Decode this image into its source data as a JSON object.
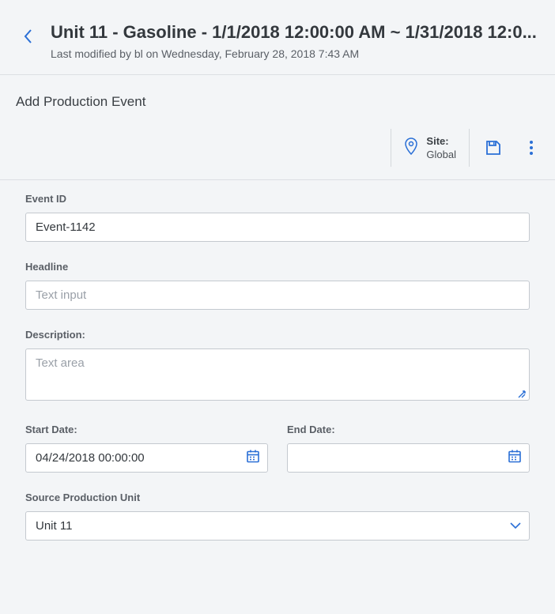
{
  "header": {
    "title": "Unit 11 - Gasoline - 1/1/2018 12:00:00 AM ~ 1/31/2018 12:0...",
    "subtitle": "Last modified by bl on Wednesday, February 28, 2018 7:43 AM"
  },
  "section_title": "Add Production Event",
  "toolbar": {
    "site_label": "Site:",
    "site_value": "Global"
  },
  "fields": {
    "event_id": {
      "label": "Event ID",
      "value": "Event-1142"
    },
    "headline": {
      "label": "Headline",
      "placeholder": "Text input",
      "value": ""
    },
    "description": {
      "label": "Description:",
      "placeholder": "Text area",
      "value": ""
    },
    "start_date": {
      "label": "Start Date:",
      "value": "04/24/2018 00:00:00"
    },
    "end_date": {
      "label": "End Date:",
      "value": ""
    },
    "source_unit": {
      "label": "Source Production Unit",
      "value": "Unit 11"
    }
  }
}
